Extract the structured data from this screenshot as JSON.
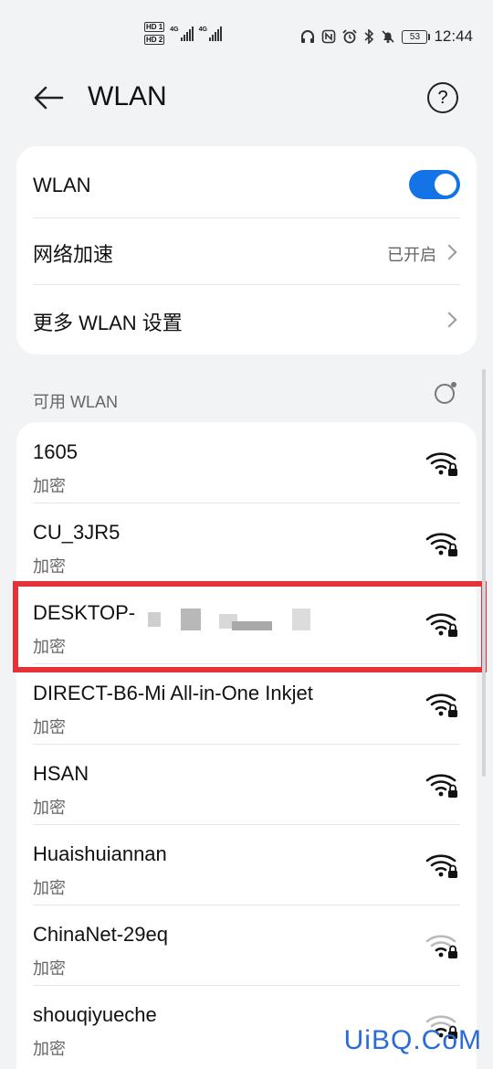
{
  "status_bar": {
    "hd1": "HD 1",
    "hd2": "HD 2",
    "net1": "4G",
    "net2": "4G",
    "battery": "53",
    "time": "12:44"
  },
  "header": {
    "title": "WLAN",
    "help_symbol": "?"
  },
  "settings_card": {
    "wlan_label": "WLAN",
    "wlan_enabled": true,
    "accel_label": "网络加速",
    "accel_value": "已开启",
    "more_label": "更多 WLAN 设置"
  },
  "available": {
    "title": "可用 WLAN",
    "networks": [
      {
        "name": "1605",
        "security": "加密",
        "signal": "strong"
      },
      {
        "name": "CU_3JR5",
        "security": "加密",
        "signal": "strong"
      },
      {
        "name": "DESKTOP-",
        "security": "加密",
        "signal": "strong"
      },
      {
        "name": "DIRECT-B6-Mi All-in-One Inkjet",
        "security": "加密",
        "signal": "strong"
      },
      {
        "name": "HSAN",
        "security": "加密",
        "signal": "strong"
      },
      {
        "name": "Huaishuiannan",
        "security": "加密",
        "signal": "strong"
      },
      {
        "name": "ChinaNet-29eq",
        "security": "加密",
        "signal": "weak"
      },
      {
        "name": "shouqiyueche",
        "security": "加密",
        "signal": "weak"
      }
    ]
  },
  "watermark": "UiBQ.CoM",
  "colors": {
    "accent": "#1473e6",
    "highlight": "#e53238",
    "background": "#f1f3f5"
  }
}
